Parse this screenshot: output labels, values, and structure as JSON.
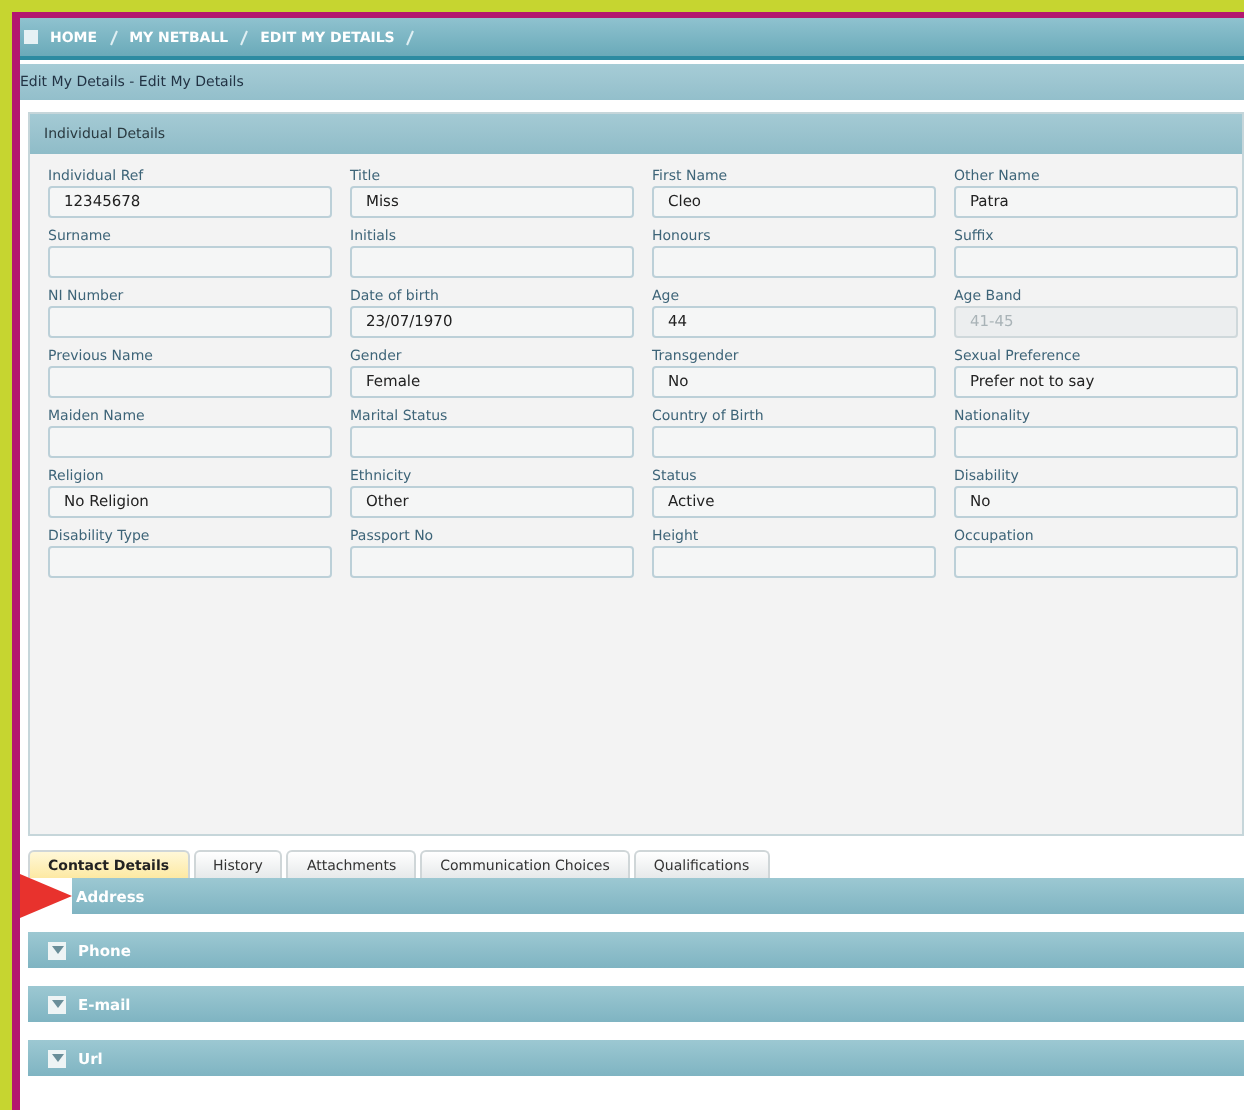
{
  "breadcrumb": [
    "HOME",
    "MY NETBALL",
    "EDIT MY DETAILS"
  ],
  "page_title": "Edit My Details - Edit My Details",
  "panel": {
    "title": "Individual Details",
    "fields": [
      {
        "label": "Individual Ref",
        "value": "12345678",
        "disabled": false
      },
      {
        "label": "Title",
        "value": "Miss",
        "disabled": false
      },
      {
        "label": "First Name",
        "value": "Cleo",
        "disabled": false
      },
      {
        "label": "Other Name",
        "value": "Patra",
        "disabled": false
      },
      {
        "label": "Surname",
        "disabled": false
      },
      {
        "label": "Initials",
        "disabled": false
      },
      {
        "label": "Honours",
        "disabled": false
      },
      {
        "label": "Suffix",
        "disabled": false
      },
      {
        "label": "NI Number",
        "disabled": false
      },
      {
        "label": "Date of birth",
        "value": "23/07/1970",
        "disabled": false
      },
      {
        "label": "Age",
        "value": "44",
        "disabled": false
      },
      {
        "label": "Age Band",
        "value": "41-45",
        "disabled": true
      },
      {
        "label": "Previous Name",
        "disabled": false
      },
      {
        "label": "Gender",
        "value": "Female",
        "disabled": false
      },
      {
        "label": "Transgender",
        "value": "No",
        "disabled": false
      },
      {
        "label": "Sexual Preference",
        "value": "Prefer not to say",
        "disabled": false
      },
      {
        "label": "Maiden Name",
        "disabled": false
      },
      {
        "label": "Marital Status",
        "disabled": false
      },
      {
        "label": "Country of Birth",
        "disabled": false
      },
      {
        "label": "Nationality",
        "disabled": false
      },
      {
        "label": "Religion",
        "value": "No Religion",
        "disabled": false
      },
      {
        "label": "Ethnicity",
        "value": "Other",
        "disabled": false
      },
      {
        "label": "Status",
        "value": "Active",
        "disabled": false
      },
      {
        "label": "Disability",
        "value": "No",
        "disabled": false
      },
      {
        "label": "Disability Type",
        "disabled": false
      },
      {
        "label": "Passport No",
        "disabled": false
      },
      {
        "label": "Height",
        "disabled": false
      },
      {
        "label": "Occupation",
        "disabled": false
      }
    ]
  },
  "tabs": [
    {
      "label": "Contact Details",
      "selected": true
    },
    {
      "label": "History",
      "selected": false
    },
    {
      "label": "Attachments",
      "selected": false
    },
    {
      "label": "Communication Choices",
      "selected": false
    },
    {
      "label": "Qualifications",
      "selected": false
    }
  ],
  "sections": [
    {
      "label": "Address",
      "pointer": true
    },
    {
      "label": "Phone",
      "pointer": false
    },
    {
      "label": "E-mail",
      "pointer": false
    },
    {
      "label": "Url",
      "pointer": false
    }
  ]
}
